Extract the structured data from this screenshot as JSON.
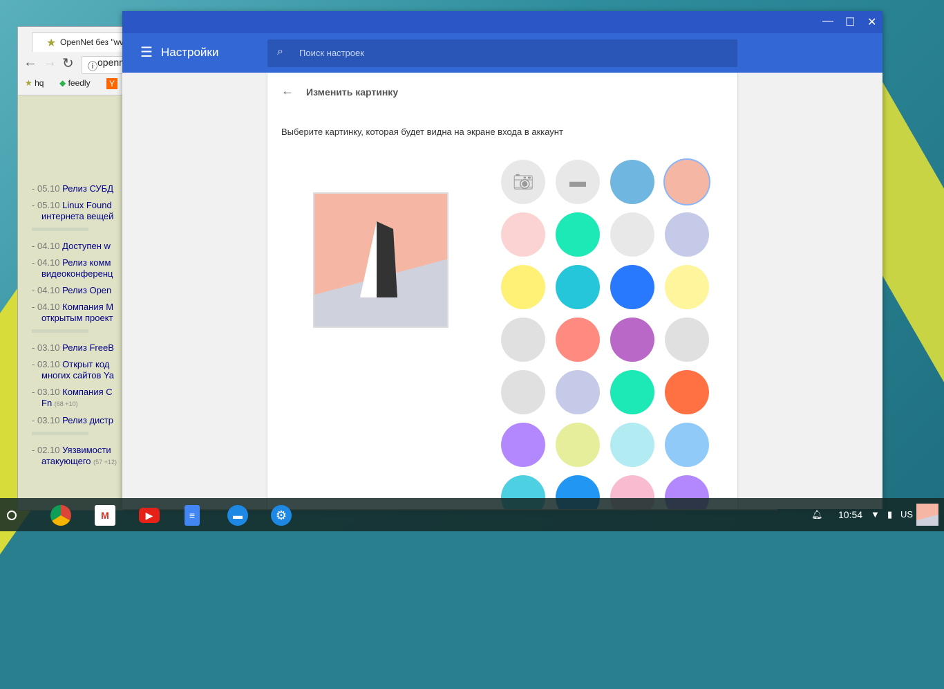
{
  "browser": {
    "tab_title": "OpenNet без \"www\"",
    "url": "openn",
    "bookmarks": [
      "hq",
      "feedly",
      "Y"
    ],
    "news": [
      {
        "date": "05.10",
        "title": "Релиз СУБД"
      },
      {
        "date": "05.10",
        "title": "Linux Found",
        "title2": "интернета вещей"
      },
      {
        "sep": true
      },
      {
        "date": "04.10",
        "title": "Доступен w"
      },
      {
        "date": "04.10",
        "title": "Релиз комм",
        "title2": "видеоконференц"
      },
      {
        "date": "04.10",
        "title": "Релиз Open"
      },
      {
        "date": "04.10",
        "title": "Компания M",
        "title2": "открытым проект"
      },
      {
        "sep": true
      },
      {
        "date": "03.10",
        "title": "Релиз FreeB"
      },
      {
        "date": "03.10",
        "title": "Открыт код",
        "title2": "многих сайтов Ya"
      },
      {
        "date": "03.10",
        "title": "Компания C",
        "title2": "Fn",
        "count": "(68 +10)"
      },
      {
        "date": "03.10",
        "title": "Релиз дистр"
      },
      {
        "sep": true
      },
      {
        "date": "02.10",
        "title": "Уязвимости",
        "title2": "атакующего",
        "count": "(57 +12)"
      }
    ]
  },
  "settings": {
    "title": "Настройки",
    "search_placeholder": "Поиск настроек",
    "page_title": "Изменить картинку",
    "description": "Выберите картинку, которая будет видна на экране входа в аккаунт",
    "avatars": [
      {
        "icon": "camera-icon",
        "color": "#e8e8e8"
      },
      {
        "icon": "folder-icon",
        "color": "#e8e8e8"
      },
      {
        "icon": "profile-photo",
        "color": "#6fb6e0"
      },
      {
        "icon": "penguin",
        "color": "#f5b7a3",
        "selected": true
      },
      {
        "icon": "fox",
        "color": "#fbd3d3"
      },
      {
        "icon": "bird",
        "color": "#1de9b6"
      },
      {
        "icon": "butterfly",
        "color": "#e8e8e8"
      },
      {
        "icon": "cat",
        "color": "#c5cae9"
      },
      {
        "icon": "corgi",
        "color": "#fff176"
      },
      {
        "icon": "rabbit",
        "color": "#26c6da"
      },
      {
        "icon": "crane",
        "color": "#2979ff"
      },
      {
        "icon": "monkey",
        "color": "#fff59d"
      },
      {
        "icon": "dragon",
        "color": "#e0e0e0"
      },
      {
        "icon": "elephant",
        "color": "#ff8a80"
      },
      {
        "icon": "panda",
        "color": "#ba68c8"
      },
      {
        "icon": "unicorn",
        "color": "#e0e0e0"
      },
      {
        "icon": "birds",
        "color": "#e0e0e0"
      },
      {
        "icon": "redbird",
        "color": "#c5cae9"
      },
      {
        "icon": "bowl",
        "color": "#1de9b6"
      },
      {
        "icon": "tamagotchi",
        "color": "#ff7043"
      },
      {
        "icon": "cheese",
        "color": "#b388ff"
      },
      {
        "icon": "football",
        "color": "#e6ee9c"
      },
      {
        "icon": "basketball",
        "color": "#b2ebf2"
      },
      {
        "icon": "vinyl",
        "color": "#90caf9"
      },
      {
        "icon": "sushi",
        "color": "#4dd0e1"
      },
      {
        "icon": "bicycle",
        "color": "#2196f3"
      },
      {
        "icon": "sunglasses",
        "color": "#f8bbd0"
      },
      {
        "icon": "cake",
        "color": "#b388ff"
      }
    ]
  },
  "shelf": {
    "time": "10:54",
    "keyboard": "US"
  }
}
